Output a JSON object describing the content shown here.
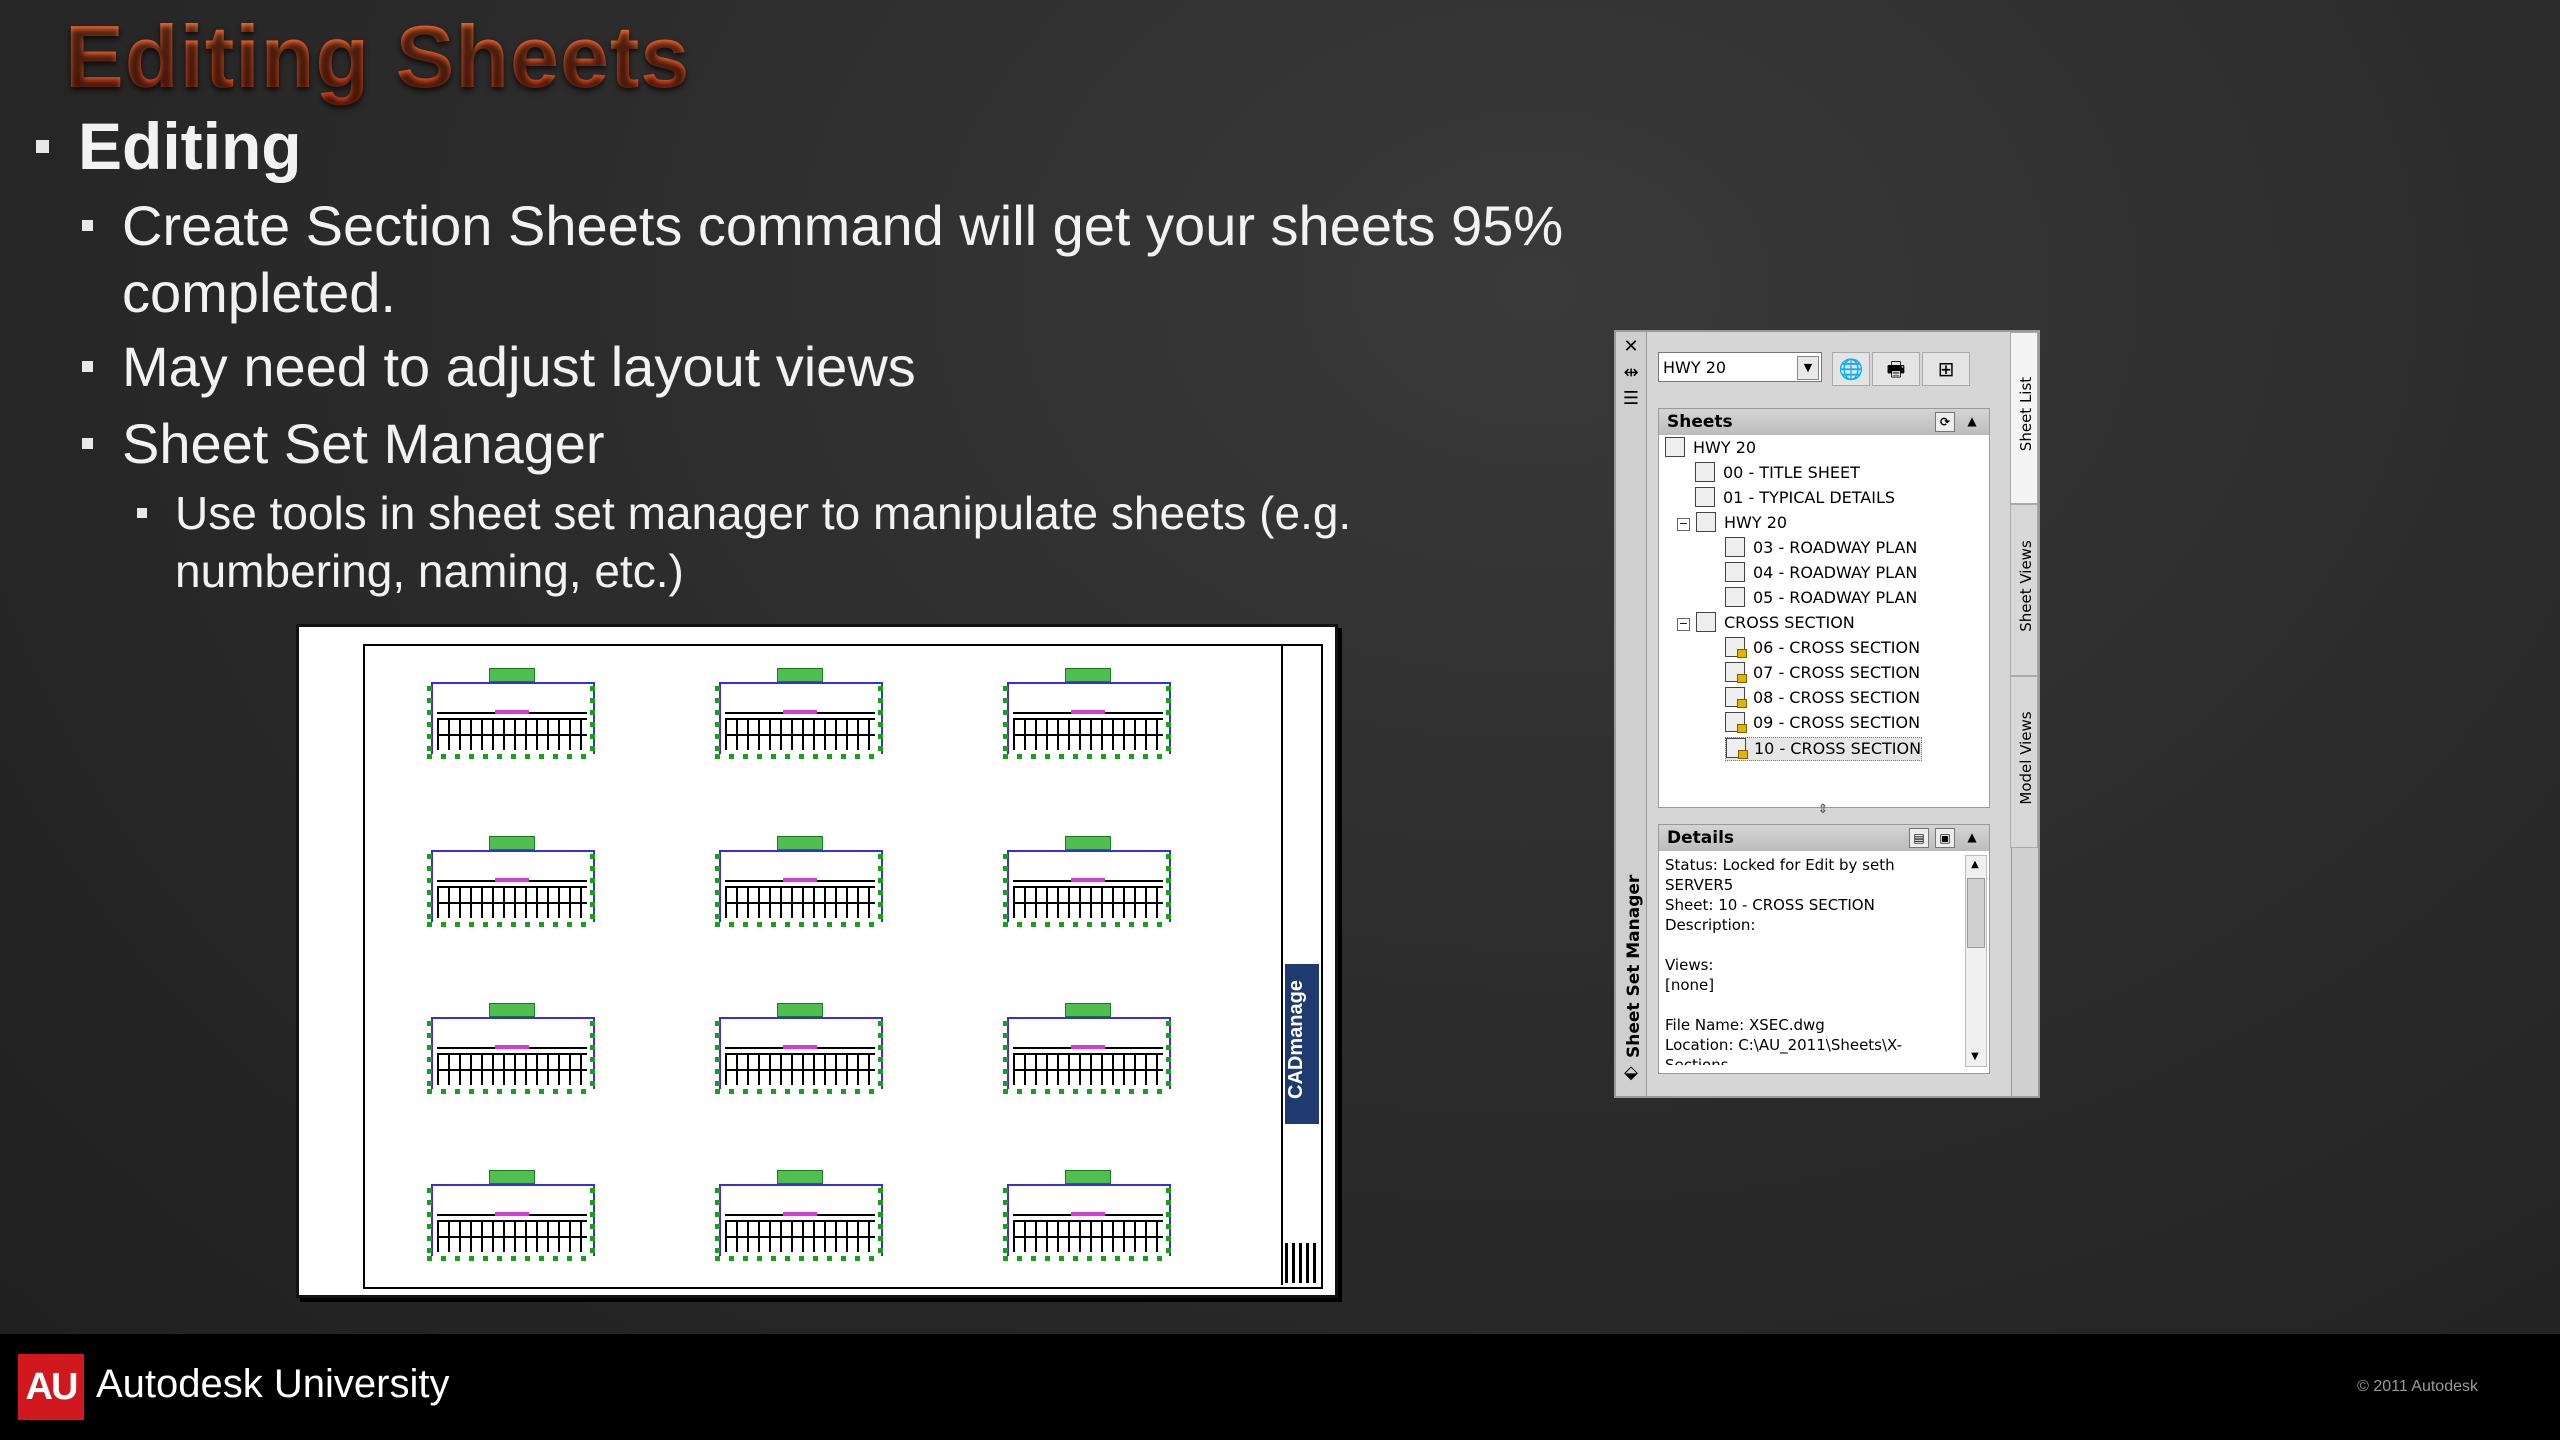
{
  "slide": {
    "title": "Editing Sheets",
    "bullets": {
      "editing": "Editing",
      "create_section": "Create Section Sheets command will get your sheets 95%",
      "create_section_cont": "completed.",
      "adjust": "May need to adjust layout views",
      "ssm": "Sheet Set Manager",
      "tools": "Use tools in sheet set manager to manipulate sheets (e.g.",
      "tools_cont": "numbering, naming, etc.)"
    }
  },
  "drawing": {
    "logo_text": "CADmanage"
  },
  "sheet_set_manager": {
    "vertical_title": "Sheet Set Manager",
    "tabs": [
      "Sheet List",
      "Sheet Views",
      "Model Views"
    ],
    "combo_value": "HWY 20",
    "sheets_header": "Sheets",
    "tree": {
      "root": "HWY 20",
      "s00": "00 - TITLE SHEET",
      "s01": "01 - TYPICAL DETAILS",
      "sub1": "HWY 20",
      "s03": "03 - ROADWAY PLAN",
      "s04": "04 - ROADWAY PLAN",
      "s05": "05 - ROADWAY PLAN",
      "sub2": "CROSS SECTION",
      "s06": "06 - CROSS SECTION",
      "s07": "07 - CROSS SECTION",
      "s08": "08 - CROSS SECTION",
      "s09": "09 - CROSS SECTION",
      "s10": "10 - CROSS SECTION"
    },
    "details_header": "Details",
    "details": {
      "status": "Status: Locked for Edit by seth",
      "server": "SERVER5",
      "sheet": "Sheet: 10 - CROSS SECTION",
      "description": "Description:",
      "views": "Views:",
      "views_val": "[none]",
      "file": "File Name: XSEC.dwg",
      "location": "Location: C:\\AU_2011\\Sheets\\X-",
      "location_cont": "Sections"
    }
  },
  "footer": {
    "logo": "AU",
    "brand": "Autodesk University",
    "copyright": "© 2011 Autodesk"
  },
  "colors": {
    "title": "#f0501e",
    "au_red": "#d0181e",
    "footer_bg": "#000000"
  }
}
